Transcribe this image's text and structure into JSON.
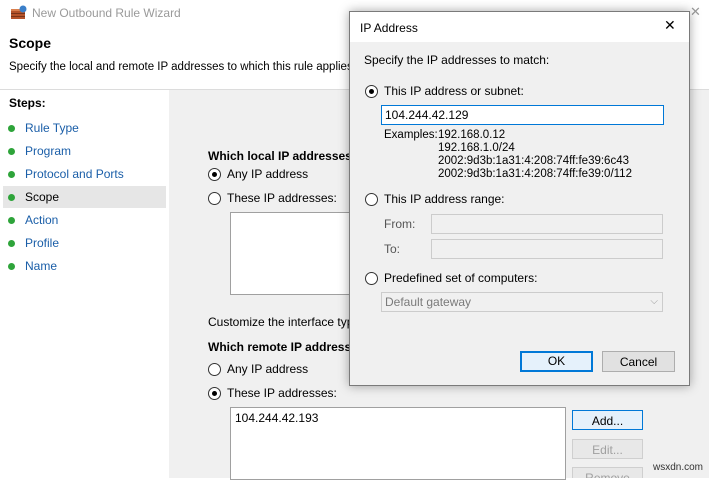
{
  "wizard": {
    "title": "New Outbound Rule Wizard",
    "close_glyph": "✕",
    "heading": "Scope",
    "subheading": "Specify the local and remote IP addresses to which this rule applies."
  },
  "steps": {
    "label": "Steps:",
    "items": [
      {
        "label": "Rule Type"
      },
      {
        "label": "Program"
      },
      {
        "label": "Protocol and Ports"
      },
      {
        "label": "Scope"
      },
      {
        "label": "Action"
      },
      {
        "label": "Profile"
      },
      {
        "label": "Name"
      }
    ],
    "active_index": 3
  },
  "scope": {
    "local_heading": "Which local IP addresses",
    "local_any": "Any IP address",
    "local_these": "These IP addresses:",
    "customize_text": "Customize the interface types t",
    "remote_heading": "Which remote IP address",
    "remote_any": "Any IP address",
    "remote_these": "These IP addresses:",
    "remote_list": [
      "104.244.42.193"
    ],
    "add_button": "Add...",
    "edit_button": "Edit...",
    "remove_button": "Remove"
  },
  "dialog": {
    "title": "IP Address",
    "close_glyph": "✕",
    "prompt": "Specify the IP addresses to match:",
    "option_subnet": "This IP address or subnet:",
    "subnet_value": "104.244.42.129",
    "examples_label": "Examples:",
    "examples": [
      "192.168.0.12",
      "192.168.1.0/24",
      "2002:9d3b:1a31:4:208:74ff:fe39:6c43",
      "2002:9d3b:1a31:4:208:74ff:fe39:0/112"
    ],
    "option_range": "This IP address range:",
    "from_label": "From:",
    "to_label": "To:",
    "option_predefined": "Predefined set of computers:",
    "predefined_value": "Default gateway",
    "ok_button": "OK",
    "cancel_button": "Cancel"
  },
  "watermark": "wsxdn.com",
  "colors": {
    "step_link": "#1a5ea8",
    "step_dot": "#2ea43a",
    "focus_border": "#0078d7"
  }
}
